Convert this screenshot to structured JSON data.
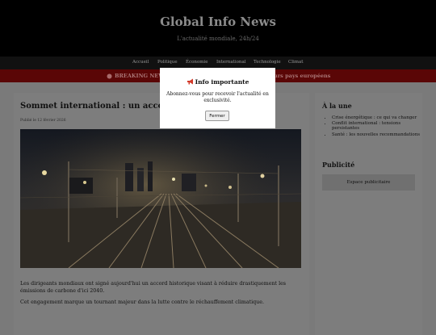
{
  "header": {
    "site_title": "Global Info News",
    "tagline": "L'actualité mondiale, 24h/24"
  },
  "nav": {
    "items": [
      "Accueil",
      "Politique",
      "Économie",
      "International",
      "Technologie",
      "Climat"
    ]
  },
  "breaking": {
    "icon": "red-circle-icon",
    "label": "BREAKING NEWS",
    "visible_tail": "urs pays européens"
  },
  "modal": {
    "icon": "megaphone-icon",
    "title": "Info importante",
    "text": "Abonnez-vous pour recevoir l'actualité en exclusivité.",
    "button": "Fermer"
  },
  "article": {
    "title": "Sommet international : un accord",
    "date": "Publié le 12 février 2026",
    "paragraphs": [
      "Les dirigeants mondiaux ont signé aujourd'hui un accord historique visant à réduire drastiquement les émissions de carbone d'ici 2040.",
      "Cet engagement marque un tournant majeur dans la lutte contre le réchauffement climatique."
    ]
  },
  "sidebar": {
    "trending_heading": "À la une",
    "trending": [
      "Crise énergétique : ce qui va changer",
      "Conflit international : tensions persistantes",
      "Santé : les nouvelles recommandations"
    ],
    "ad_heading": "Publicité",
    "ad_text": "Espace publicitaire"
  },
  "colors": {
    "header_bg": "#000000",
    "breaking_bg": "#5a0606",
    "overlay_bg": "#7a7a7a"
  }
}
